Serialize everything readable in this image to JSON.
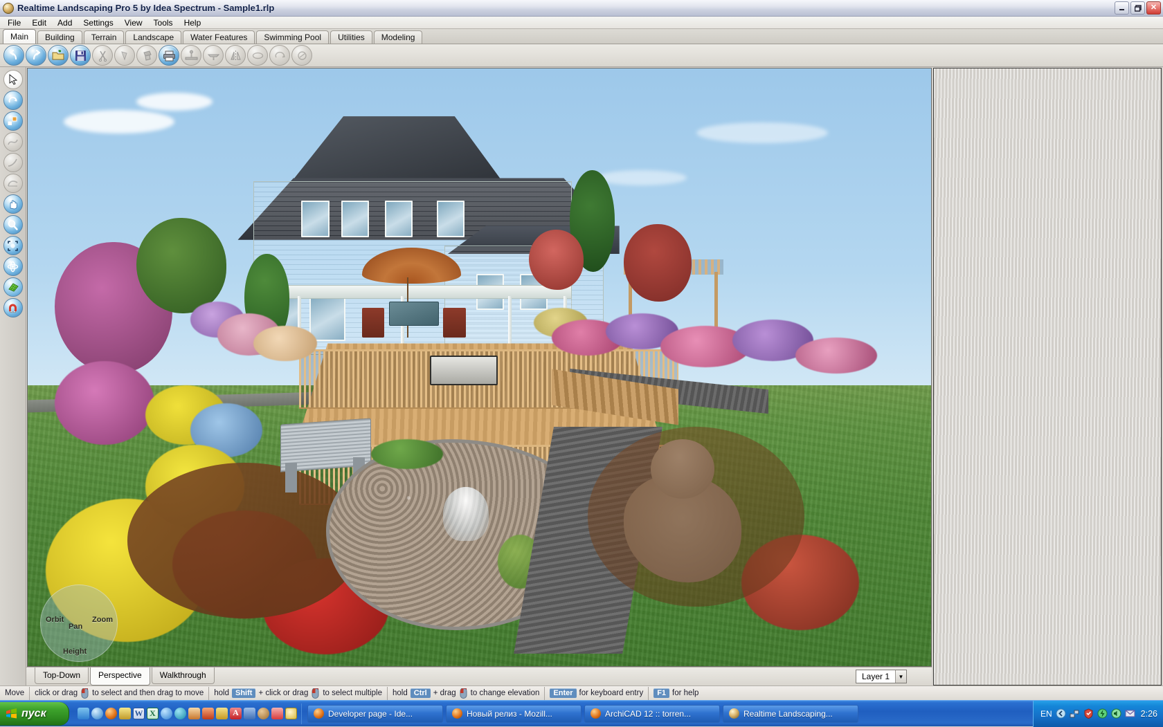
{
  "window": {
    "title": "Realtime Landscaping Pro 5 by Idea Spectrum - Sample1.rlp",
    "app_icon": "globe-icon",
    "minimize": "_",
    "maximize": "❐",
    "close": "✕"
  },
  "menu": [
    {
      "label": "File"
    },
    {
      "label": "Edit"
    },
    {
      "label": "Add"
    },
    {
      "label": "Settings"
    },
    {
      "label": "View"
    },
    {
      "label": "Tools"
    },
    {
      "label": "Help"
    }
  ],
  "ribbon_tabs": [
    {
      "label": "Main",
      "active": true
    },
    {
      "label": "Building",
      "active": false
    },
    {
      "label": "Terrain",
      "active": false
    },
    {
      "label": "Landscape",
      "active": false
    },
    {
      "label": "Water Features",
      "active": false
    },
    {
      "label": "Swimming Pool",
      "active": false
    },
    {
      "label": "Utilities",
      "active": false
    },
    {
      "label": "Modeling",
      "active": false
    }
  ],
  "toolbar": [
    {
      "name": "undo-icon",
      "style": "blue",
      "enabled": true
    },
    {
      "name": "redo-icon",
      "style": "blue",
      "enabled": true
    },
    {
      "name": "open-folder-icon",
      "style": "blue",
      "enabled": true
    },
    {
      "name": "save-icon",
      "style": "blue",
      "enabled": true
    },
    {
      "name": "cut-icon",
      "style": "gray",
      "enabled": false
    },
    {
      "name": "copy-icon",
      "style": "gray",
      "enabled": false
    },
    {
      "name": "paste-icon",
      "style": "gray",
      "enabled": false
    },
    {
      "name": "print-icon",
      "style": "blue",
      "enabled": true
    },
    {
      "name": "ground-level-icon",
      "style": "gray",
      "enabled": false
    },
    {
      "name": "flatten-icon",
      "style": "gray",
      "enabled": false
    },
    {
      "name": "mirror-icon",
      "style": "gray",
      "enabled": false
    },
    {
      "name": "stretch-icon",
      "style": "gray",
      "enabled": false
    },
    {
      "name": "rotate-icon",
      "style": "gray",
      "enabled": false
    },
    {
      "name": "scale-icon",
      "style": "gray",
      "enabled": false
    }
  ],
  "left_tools": [
    {
      "name": "select-arrow-icon",
      "style": "white",
      "enabled": true
    },
    {
      "name": "rotate-object-icon",
      "style": "blue",
      "enabled": true
    },
    {
      "name": "scale-object-icon",
      "style": "blue",
      "enabled": true
    },
    {
      "name": "draw-curve-icon",
      "style": "gray",
      "enabled": false
    },
    {
      "name": "draw-line-icon",
      "style": "gray",
      "enabled": false
    },
    {
      "name": "draw-region-icon",
      "style": "gray",
      "enabled": false
    },
    {
      "name": "pan-hand-icon",
      "style": "blue",
      "enabled": true
    },
    {
      "name": "zoom-icon",
      "style": "blue",
      "enabled": true
    },
    {
      "name": "zoom-extents-icon",
      "style": "blue",
      "enabled": true
    },
    {
      "name": "orbit-icon",
      "style": "blue",
      "enabled": true
    },
    {
      "name": "grid-icon",
      "style": "green",
      "enabled": true
    },
    {
      "name": "magnet-snap-icon",
      "style": "blue",
      "enabled": true
    }
  ],
  "viewport": {
    "nav_widget": {
      "orbit": "Orbit",
      "zoom": "Zoom",
      "pan": "Pan",
      "height": "Height"
    }
  },
  "view_tabs": [
    {
      "label": "Top-Down",
      "active": false
    },
    {
      "label": "Perspective",
      "active": true
    },
    {
      "label": "Walkthrough",
      "active": false
    }
  ],
  "layer_selector": {
    "value": "Layer 1",
    "arrow": "▼"
  },
  "statusbar": {
    "mode": "Move",
    "segments": [
      {
        "prefix": "click or drag",
        "key": "",
        "mouse": true,
        "suffix": "to select and then drag to move"
      },
      {
        "prefix": "hold",
        "key": "Shift",
        "mouse": true,
        "mid": "+ click or drag",
        "suffix": "to select multiple"
      },
      {
        "prefix": "hold",
        "key": "Ctrl",
        "mouse": true,
        "mid": "+ drag",
        "suffix": "to change elevation"
      },
      {
        "prefix": "",
        "key": "Enter",
        "mouse": false,
        "suffix": "for keyboard entry"
      },
      {
        "prefix": "",
        "key": "F1",
        "mouse": false,
        "suffix": "for help"
      }
    ]
  },
  "taskbar": {
    "start_label": "пуск",
    "quick_launch": [
      {
        "name": "show-desktop-icon",
        "color": "#2f7fd0"
      },
      {
        "name": "internet-explorer-icon",
        "color": "#2a7cc7"
      },
      {
        "name": "firefox-icon",
        "color": "#e2751b"
      },
      {
        "name": "paint-icon",
        "color": "#d8c04a"
      },
      {
        "name": "word-icon",
        "color": "#2b579a"
      },
      {
        "name": "excel-icon",
        "color": "#1d7044"
      },
      {
        "name": "media-player-icon",
        "color": "#2f7fd0"
      },
      {
        "name": "k-lite-icon",
        "color": "#28a0c4"
      },
      {
        "name": "nero-icon",
        "color": "#c7762d"
      },
      {
        "name": "winamp-icon",
        "color": "#d14a24"
      },
      {
        "name": "winrar-icon",
        "color": "#d7b23c"
      },
      {
        "name": "acrobat-icon",
        "color": "#c32026"
      },
      {
        "name": "usb-drive-icon",
        "color": "#3f6fb5"
      },
      {
        "name": "photoshop-icon",
        "color": "#9c6a2a"
      },
      {
        "name": "ebay-icon",
        "color": "#d93b3b"
      },
      {
        "name": "clock-icon",
        "color": "#d8c34a"
      }
    ],
    "tasks": [
      {
        "label": "Developer page - Ide...",
        "icon": "firefox-icon",
        "active": false
      },
      {
        "label": "Новый релиз - Mozill...",
        "icon": "firefox-icon",
        "active": false
      },
      {
        "label": "ArchiCAD 12 :: torren...",
        "icon": "firefox-icon",
        "active": false
      },
      {
        "label": "Realtime Landscaping...",
        "icon": "globe-icon",
        "active": true
      }
    ],
    "tray": {
      "language": "EN",
      "icons": [
        {
          "name": "show-hidden-icons-arrow",
          "color": "#bfe0f4"
        },
        {
          "name": "network-icon",
          "color": "#5fb0ee"
        },
        {
          "name": "kaspersky-icon",
          "color": "#d94a3d"
        },
        {
          "name": "power-icon",
          "color": "#2ca04a"
        },
        {
          "name": "volume-icon",
          "color": "#3fae5a"
        },
        {
          "name": "mail-icon",
          "color": "#d9d9e8"
        }
      ],
      "clock": "2:26"
    }
  }
}
